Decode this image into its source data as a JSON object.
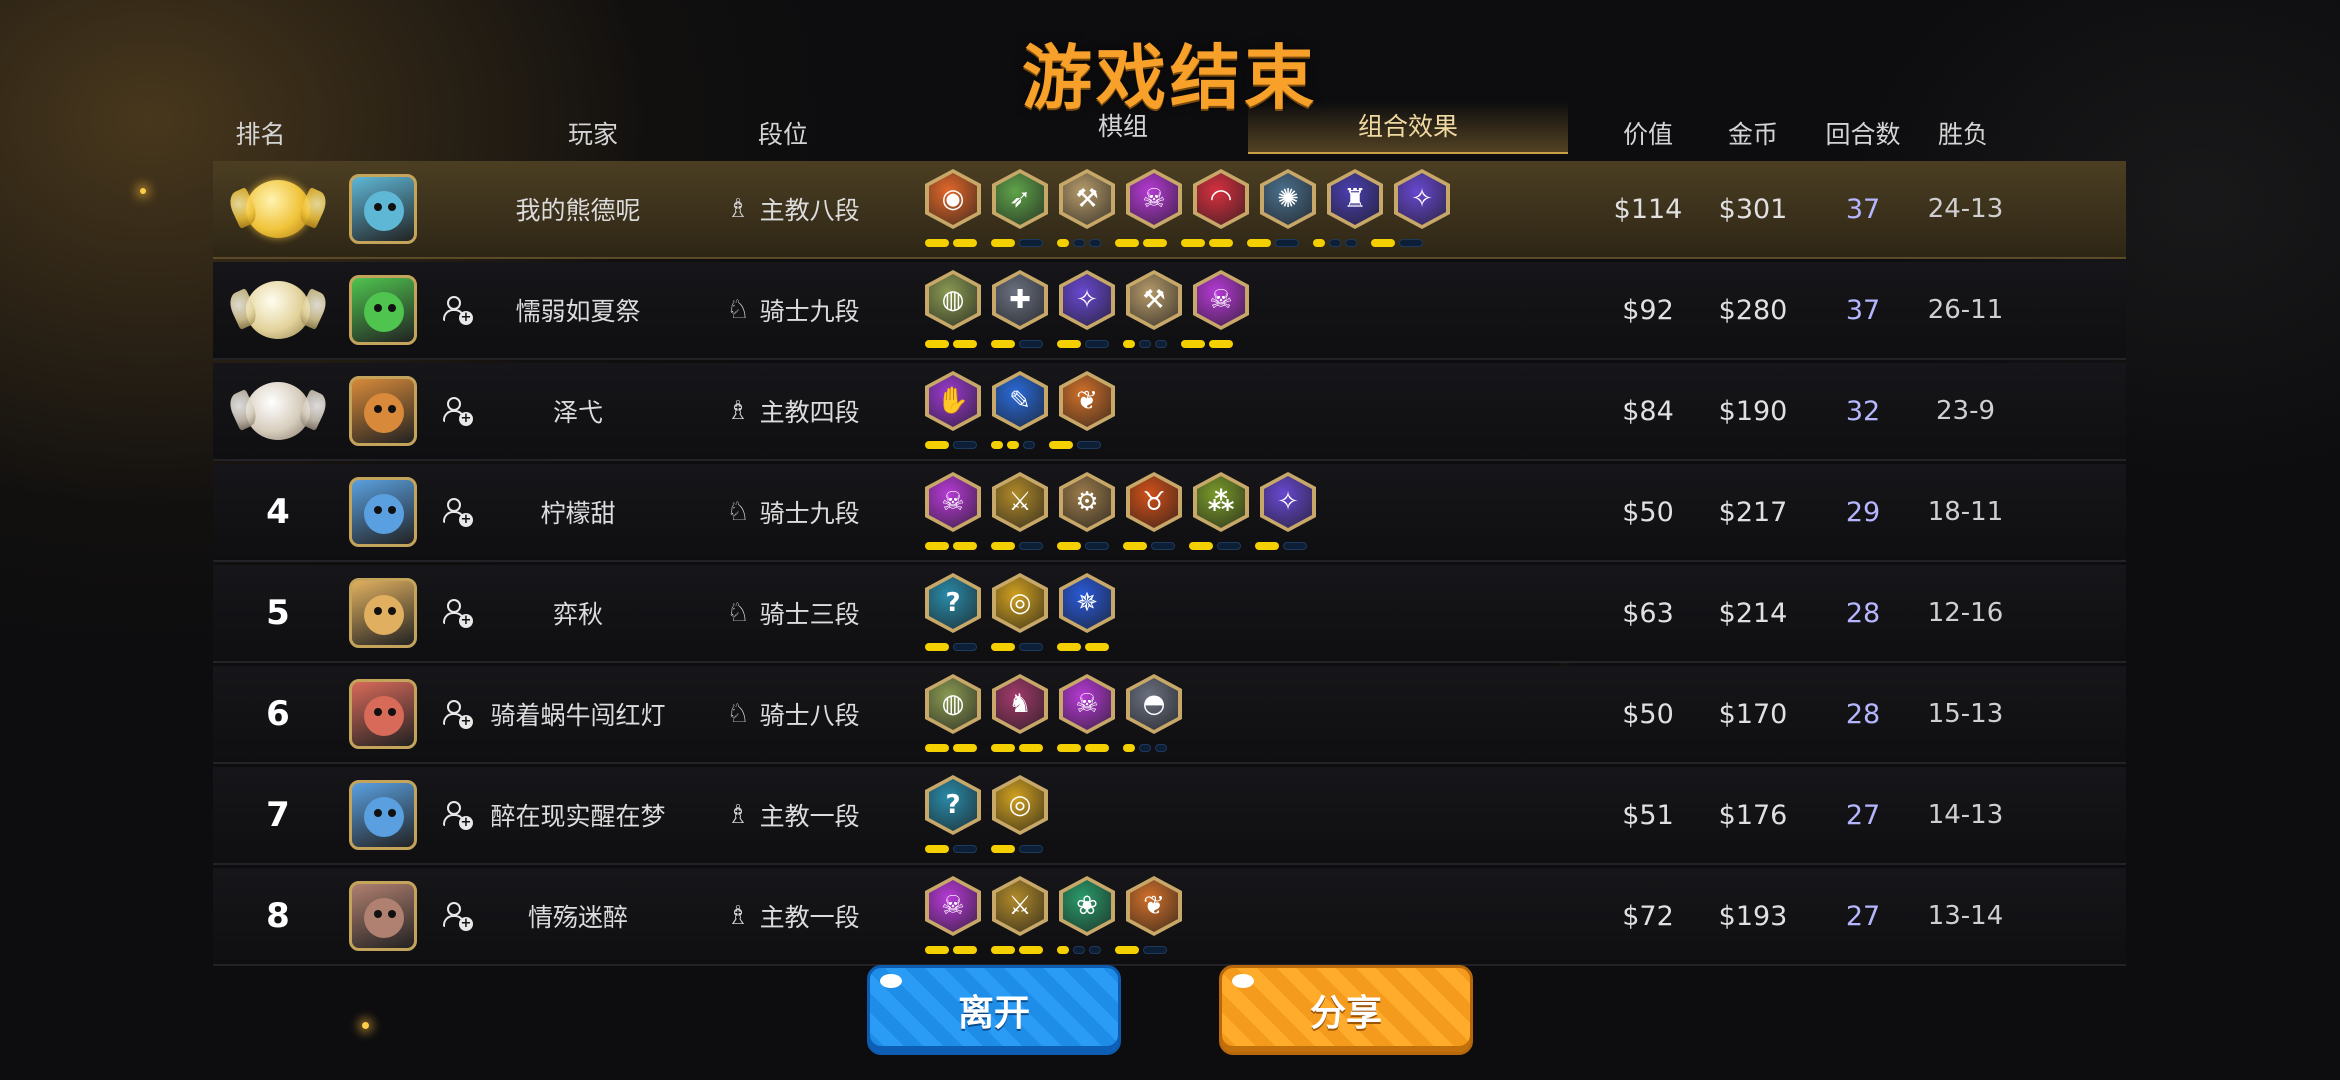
{
  "title": "游戏结束",
  "headers": {
    "rank": "排名",
    "player": "玩家",
    "tier": "段位",
    "lineup": "棋组",
    "synergy": "组合效果",
    "value": "价值",
    "gold": "金币",
    "rounds": "回合数",
    "winloss": "胜负"
  },
  "colors": {
    "title": "#f7a12a",
    "bar_on": "#f5d000",
    "bar_off": "#0d1f36",
    "rounds_text": "#b6b6ff",
    "leave_button": "#2a9cf5",
    "share_button": "#ffab2c"
  },
  "rows": [
    {
      "rank": "1",
      "medal": "gold-medal-icon",
      "avatar_color": "#5fb7d6",
      "name": "我的熊德呢",
      "tier_icon": "bishop-icon",
      "tier": "主教八段",
      "value": "$114",
      "gold": "$301",
      "rounds": "37",
      "winloss": "24-13",
      "is_self": true,
      "synergies": [
        {
          "icon": "mech-icon",
          "color": "#e2682a"
        },
        {
          "icon": "ranger-icon",
          "color": "#5fa34a"
        },
        {
          "icon": "axe-icon",
          "color": "#b59a6a"
        },
        {
          "icon": "skull-icon",
          "color": "#b63ad6"
        },
        {
          "icon": "arc-icon",
          "color": "#d83040"
        },
        {
          "icon": "orb-icon",
          "color": "#4a6f8c"
        },
        {
          "icon": "demon-icon",
          "color": "#4a3fb0"
        },
        {
          "icon": "fish-icon",
          "color": "#6848d0"
        }
      ],
      "bars": [
        [
          1,
          1
        ],
        [
          1,
          0
        ],
        [
          1,
          0,
          0
        ],
        [
          1,
          1
        ],
        [
          1,
          1
        ],
        [
          1,
          0
        ],
        [
          1,
          0,
          0
        ],
        [
          1,
          0
        ]
      ]
    },
    {
      "rank": "2",
      "medal": "silver-medal-icon",
      "avatar_color": "#4fc44f",
      "name": "懦弱如夏祭",
      "tier_icon": "knight-icon",
      "tier": "骑士九段",
      "value": "$92",
      "gold": "$280",
      "rounds": "37",
      "winloss": "26-11",
      "is_self": false,
      "synergies": [
        {
          "icon": "egg-icon",
          "color": "#8a9a52"
        },
        {
          "icon": "cross-icon",
          "color": "#6a7080"
        },
        {
          "icon": "fish-icon",
          "color": "#6848d0"
        },
        {
          "icon": "axe-icon",
          "color": "#b59a6a"
        },
        {
          "icon": "skull-icon",
          "color": "#b63ad6"
        }
      ],
      "bars": [
        [
          1,
          1
        ],
        [
          1,
          0
        ],
        [
          1,
          0
        ],
        [
          1,
          0,
          0
        ],
        [
          1,
          1
        ]
      ]
    },
    {
      "rank": "3",
      "medal": "bronze-medal-icon",
      "avatar_color": "#d88a3a",
      "name": "泽弋",
      "tier_icon": "bishop-icon",
      "tier": "主教四段",
      "value": "$84",
      "gold": "$190",
      "rounds": "32",
      "winloss": "23-9",
      "is_self": false,
      "synergies": [
        {
          "icon": "hand-icon",
          "color": "#9a3ad0"
        },
        {
          "icon": "feather-icon",
          "color": "#2a6ad8"
        },
        {
          "icon": "leaf-icon",
          "color": "#d0702a"
        }
      ],
      "bars": [
        [
          1,
          0
        ],
        [
          1,
          1,
          0
        ],
        [
          1,
          0
        ]
      ]
    },
    {
      "rank": "4",
      "medal": "",
      "avatar_color": "#5aa0e0",
      "name": "柠檬甜",
      "tier_icon": "knight-icon",
      "tier": "骑士九段",
      "value": "$50",
      "gold": "$217",
      "rounds": "29",
      "winloss": "18-11",
      "is_self": false,
      "synergies": [
        {
          "icon": "skull-icon",
          "color": "#b63ad6"
        },
        {
          "icon": "blades-icon",
          "color": "#b08a2a"
        },
        {
          "icon": "gear-icon",
          "color": "#9a7a4a"
        },
        {
          "icon": "goblin-icon",
          "color": "#d0501a"
        },
        {
          "icon": "triad-icon",
          "color": "#7a9a2a"
        },
        {
          "icon": "fish-icon",
          "color": "#6848d0"
        }
      ],
      "bars": [
        [
          1,
          1
        ],
        [
          1,
          0
        ],
        [
          1,
          0
        ],
        [
          1,
          0
        ],
        [
          1,
          0
        ],
        [
          1,
          0
        ]
      ]
    },
    {
      "rank": "5",
      "medal": "",
      "avatar_color": "#e0b060",
      "name": "弈秋",
      "tier_icon": "knight-icon",
      "tier": "骑士三段",
      "value": "$63",
      "gold": "$214",
      "rounds": "28",
      "winloss": "12-16",
      "is_self": false,
      "synergies": [
        {
          "icon": "hook-icon",
          "color": "#2a8aa8"
        },
        {
          "icon": "ring-icon",
          "color": "#d0a020"
        },
        {
          "icon": "dragon-icon",
          "color": "#2a5ad8"
        }
      ],
      "bars": [
        [
          1,
          0
        ],
        [
          1,
          0
        ],
        [
          1,
          1
        ]
      ]
    },
    {
      "rank": "6",
      "medal": "",
      "avatar_color": "#d86a5a",
      "name": "骑着蜗牛闯红灯",
      "tier_icon": "knight-icon",
      "tier": "骑士八段",
      "value": "$50",
      "gold": "$170",
      "rounds": "28",
      "winloss": "15-13",
      "is_self": false,
      "synergies": [
        {
          "icon": "egg-icon",
          "color": "#8a9a52"
        },
        {
          "icon": "knight-piece-icon",
          "color": "#a03a6a"
        },
        {
          "icon": "skull-icon",
          "color": "#b63ad6"
        },
        {
          "icon": "helmet-icon",
          "color": "#6a7080"
        }
      ],
      "bars": [
        [
          1,
          1
        ],
        [
          1,
          1
        ],
        [
          1,
          1
        ],
        [
          1,
          0,
          0
        ]
      ]
    },
    {
      "rank": "7",
      "medal": "",
      "avatar_color": "#5aa0e0",
      "name": "醉在现实醒在梦",
      "tier_icon": "bishop-icon",
      "tier": "主教一段",
      "value": "$51",
      "gold": "$176",
      "rounds": "27",
      "winloss": "14-13",
      "is_self": false,
      "synergies": [
        {
          "icon": "hook-icon",
          "color": "#2a8aa8"
        },
        {
          "icon": "ring-icon",
          "color": "#d0a020"
        }
      ],
      "bars": [
        [
          1,
          0
        ],
        [
          1,
          0
        ]
      ]
    },
    {
      "rank": "8",
      "medal": "",
      "avatar_color": "#b08070",
      "name": "情殇迷醉",
      "tier_icon": "bishop-icon",
      "tier": "主教一段",
      "value": "$72",
      "gold": "$193",
      "rounds": "27",
      "winloss": "13-14",
      "is_self": false,
      "synergies": [
        {
          "icon": "skull-icon",
          "color": "#b63ad6"
        },
        {
          "icon": "blades-icon",
          "color": "#b08a2a"
        },
        {
          "icon": "paw-icon",
          "color": "#2a9a6a"
        },
        {
          "icon": "leaf-icon",
          "color": "#d0702a"
        }
      ],
      "bars": [
        [
          1,
          1
        ],
        [
          1,
          1
        ],
        [
          1,
          0,
          0
        ],
        [
          1,
          0
        ]
      ]
    }
  ],
  "buttons": {
    "leave": "离开",
    "share": "分享"
  }
}
